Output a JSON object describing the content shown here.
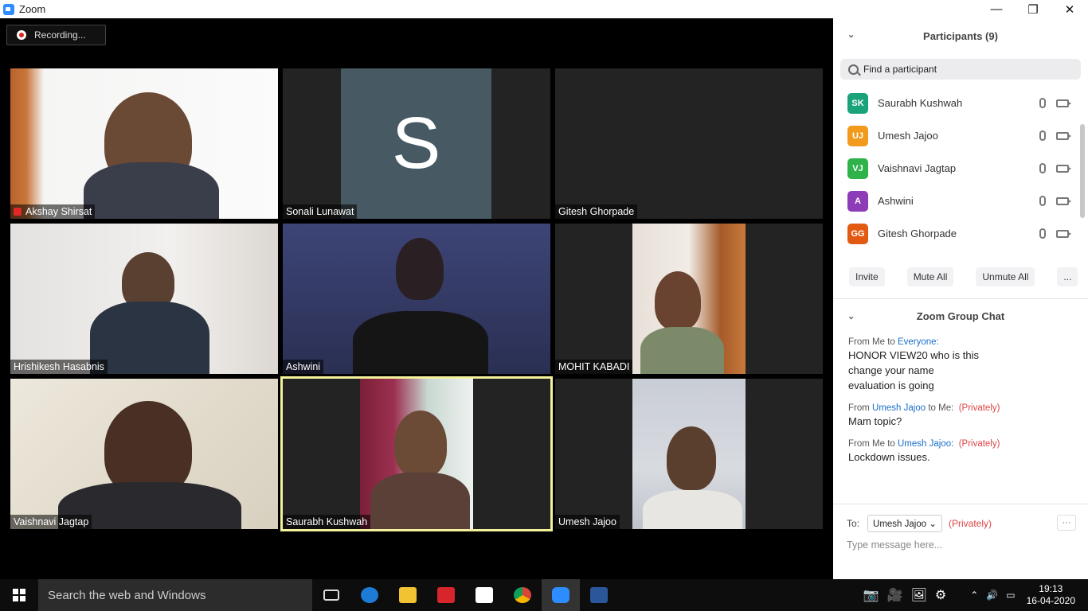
{
  "window": {
    "title": "Zoom"
  },
  "recording": {
    "label": "Recording..."
  },
  "tiles": [
    {
      "name": "Akshay Shirsat",
      "muted": true
    },
    {
      "name": "Sonali Lunawat",
      "avatar_letter": "S"
    },
    {
      "name": "Gitesh Ghorpade"
    },
    {
      "name": "Hrishikesh Hasabnis"
    },
    {
      "name": "Ashwini"
    },
    {
      "name": "MOHIT KABADI"
    },
    {
      "name": "Vaishnavi Jagtap"
    },
    {
      "name": "Saurabh Kushwah",
      "active_speaker": true
    },
    {
      "name": "Umesh Jajoo"
    }
  ],
  "participants": {
    "title": "Participants (9)",
    "search_placeholder": "Find a participant",
    "list": [
      {
        "initials": "SK",
        "name": "Saurabh Kushwah",
        "color": "#1aa37a"
      },
      {
        "initials": "UJ",
        "name": "Umesh Jajoo",
        "color": "#f29a1b"
      },
      {
        "initials": "VJ",
        "name": "Vaishnavi Jagtap",
        "color": "#2fb24a"
      },
      {
        "initials": "A",
        "name": "Ashwini",
        "color": "#8d3bb7"
      },
      {
        "initials": "GG",
        "name": "Gitesh Ghorpade",
        "color": "#e25a12"
      }
    ],
    "buttons": {
      "invite": "Invite",
      "mute_all": "Mute All",
      "unmute_all": "Unmute All",
      "more": "..."
    }
  },
  "chat": {
    "title": "Zoom Group Chat",
    "messages": [
      {
        "prefix": "From Me to ",
        "target": "Everyone:",
        "private": "",
        "lines": [
          "HONOR VIEW20 who is this",
          "change your name",
          "evaluation is going"
        ]
      },
      {
        "prefix": "From ",
        "target": "Umesh Jajoo",
        "suffix": " to Me:",
        "private": "(Privately)",
        "lines": [
          "Mam topic?"
        ]
      },
      {
        "prefix": "From Me to ",
        "target": "Umesh Jajoo:",
        "private": "(Privately)",
        "lines": [
          "Lockdown issues."
        ]
      }
    ],
    "to_label": "To:",
    "to_value": "Umesh Jajoo",
    "to_private": "(Privately)",
    "input_placeholder": "Type message here...",
    "more": "···"
  },
  "taskbar": {
    "search_placeholder": "Search the web and Windows",
    "time": "19:13",
    "date": "16-04-2020"
  }
}
